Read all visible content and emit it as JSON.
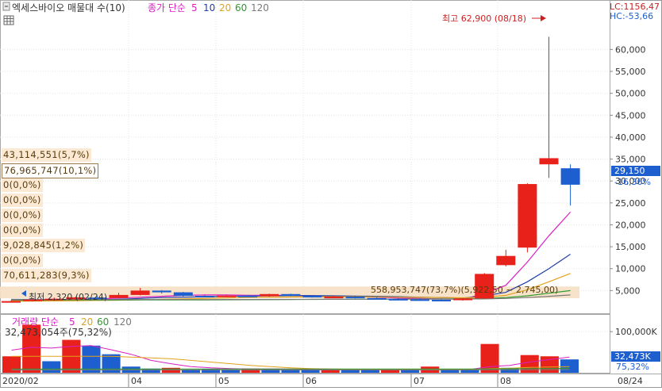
{
  "header": {
    "title": "엑세스바이오 매물대 수(10)",
    "ma_label": "종가 단순",
    "ma_periods": [
      "5",
      "10",
      "20",
      "60",
      "120"
    ]
  },
  "volume_header": {
    "label": "거래량 단순",
    "ma_periods": [
      "5",
      "20",
      "60",
      "120"
    ],
    "reading": "32,473,054주(75,32%)"
  },
  "top_right": {
    "lc": "LC:1156,47",
    "hc": "HC:-53,66"
  },
  "annotations": {
    "high": "최고 62,900 (08/18)",
    "low": "최저 2,320 (02/24)",
    "current_price": "29,150",
    "current_change": "-16,36%",
    "current_volume": "32,473K",
    "current_volume_ratio": "75,32%",
    "volume_profile_peak": "558,953,747(73,7%)(5,922,50 ~ 2,745,00)"
  },
  "volume_profile_labels": [
    "43,114,551(5,7%)",
    "76,965,747(10,1%)",
    "0(0,0%)",
    "0(0,0%)",
    "0(0,0%)",
    "0(0,0%)",
    "9,028,845(1,2%)",
    "0(0,0%)",
    "70,611,283(9,3%)"
  ],
  "colors": {
    "up": "#e8211b",
    "down": "#1e5fd0",
    "ma5": "#d81fc4",
    "ma10": "#1f3fa8",
    "ma20": "#e2a21a",
    "ma60": "#2f9a2f",
    "ma120": "#7a7a7a",
    "profile": "#f6dfc4",
    "accent": "#cc1f1f"
  },
  "chart_data": [
    {
      "type": "candlestick",
      "title": "엑세스바이오 매물대 수(10)",
      "y_axis": {
        "ticks": [
          "5,000",
          "10,000",
          "15,000",
          "20,000",
          "25,000",
          "30,000",
          "35,000",
          "40,000",
          "45,000",
          "50,000",
          "55,000",
          "60,000"
        ],
        "tick_values": [
          5000,
          10000,
          15000,
          20000,
          25000,
          30000,
          35000,
          40000,
          45000,
          50000,
          55000,
          60000
        ],
        "ylim": [
          0,
          65500
        ]
      },
      "x_axis": {
        "tick_labels": [
          "2020/02",
          "04",
          "05",
          "06",
          "07",
          "08",
          "08/24"
        ]
      },
      "candles": [
        {
          "period": "02-1",
          "open": 2500,
          "high": 2750,
          "low": 2320,
          "close": 2600
        },
        {
          "period": "02-2",
          "open": 2650,
          "high": 3000,
          "low": 2500,
          "close": 2950
        },
        {
          "period": "03-1",
          "open": 2900,
          "high": 3400,
          "low": 2700,
          "close": 3150
        },
        {
          "period": "03-2",
          "open": 3000,
          "high": 3600,
          "low": 2800,
          "close": 3450
        },
        {
          "period": "03-3",
          "open": 3400,
          "high": 3800,
          "low": 3200,
          "close": 3300
        },
        {
          "period": "03-4",
          "open": 3300,
          "high": 4500,
          "low": 3200,
          "close": 4000
        },
        {
          "period": "03-5",
          "open": 4000,
          "high": 5600,
          "low": 3900,
          "close": 5000
        },
        {
          "period": "04-1",
          "open": 5000,
          "high": 5100,
          "low": 4300,
          "close": 4600
        },
        {
          "period": "04-2",
          "open": 4600,
          "high": 4700,
          "low": 3600,
          "close": 3800
        },
        {
          "period": "04-3",
          "open": 3800,
          "high": 4000,
          "low": 3500,
          "close": 3700
        },
        {
          "period": "04-4",
          "open": 3700,
          "high": 3950,
          "low": 3500,
          "close": 3850
        },
        {
          "period": "05-1",
          "open": 3850,
          "high": 4000,
          "low": 3600,
          "close": 3700
        },
        {
          "period": "05-2",
          "open": 3700,
          "high": 4300,
          "low": 3600,
          "close": 4200
        },
        {
          "period": "05-3",
          "open": 4200,
          "high": 4300,
          "low": 3700,
          "close": 3800
        },
        {
          "period": "05-4",
          "open": 3800,
          "high": 3900,
          "low": 3400,
          "close": 3500
        },
        {
          "period": "06-1",
          "open": 3500,
          "high": 3800,
          "low": 3300,
          "close": 3600
        },
        {
          "period": "06-2",
          "open": 3600,
          "high": 3700,
          "low": 3200,
          "close": 3300
        },
        {
          "period": "06-3",
          "open": 3300,
          "high": 3500,
          "low": 3000,
          "close": 3100
        },
        {
          "period": "06-4",
          "open": 3100,
          "high": 3300,
          "low": 2900,
          "close": 3000
        },
        {
          "period": "07-1",
          "open": 3000,
          "high": 3200,
          "low": 2700,
          "close": 2900
        },
        {
          "period": "07-2",
          "open": 2900,
          "high": 3000,
          "low": 2700,
          "close": 2800
        },
        {
          "period": "07-3",
          "open": 2800,
          "high": 3300,
          "low": 2700,
          "close": 3200
        },
        {
          "period": "07-4",
          "open": 3200,
          "high": 9000,
          "low": 3100,
          "close": 8800
        },
        {
          "period": "08-1",
          "open": 10800,
          "high": 14300,
          "low": 10500,
          "close": 12900
        },
        {
          "period": "08-2",
          "open": 14800,
          "high": 29500,
          "low": 13700,
          "close": 29300
        },
        {
          "period": "08-3",
          "open": 33800,
          "high": 62900,
          "low": 30700,
          "close": 35200
        },
        {
          "period": "08-4",
          "open": 32900,
          "high": 33800,
          "low": 24400,
          "close": 29150
        }
      ],
      "moving_averages": [
        {
          "name": "5",
          "values": [
            2700,
            2800,
            2900,
            3000,
            3100,
            3300,
            3500,
            3700,
            3900,
            4000,
            4000,
            3900,
            3900,
            3900,
            3800,
            3700,
            3600,
            3500,
            3300,
            3200,
            3100,
            3000,
            4300,
            6200,
            11500,
            17500,
            22900
          ]
        },
        {
          "name": "10",
          "values": [
            2600,
            2650,
            2700,
            2800,
            2900,
            3000,
            3200,
            3400,
            3500,
            3600,
            3700,
            3750,
            3800,
            3850,
            3850,
            3800,
            3750,
            3700,
            3600,
            3500,
            3400,
            3300,
            3800,
            4600,
            7000,
            10000,
            13300
          ]
        },
        {
          "name": "20",
          "values": [
            2600,
            2600,
            2650,
            2700,
            2750,
            2800,
            2900,
            3000,
            3100,
            3200,
            3300,
            3400,
            3500,
            3550,
            3600,
            3600,
            3600,
            3550,
            3500,
            3450,
            3400,
            3350,
            3500,
            3900,
            5200,
            7000,
            8900
          ]
        },
        {
          "name": "60",
          "values": [
            2900,
            2880,
            2860,
            2850,
            2840,
            2840,
            2850,
            2860,
            2870,
            2880,
            2900,
            2920,
            2940,
            2960,
            2980,
            3000,
            3020,
            3040,
            3060,
            3080,
            3100,
            3120,
            3200,
            3400,
            3800,
            4400,
            5000
          ]
        },
        {
          "name": "120",
          "values": [
            3000,
            2990,
            2980,
            2970,
            2960,
            2950,
            2950,
            2950,
            2950,
            2950,
            2960,
            2970,
            2980,
            2990,
            3000,
            3010,
            3020,
            3030,
            3040,
            3050,
            3060,
            3070,
            3100,
            3200,
            3400,
            3700,
            4000
          ]
        }
      ],
      "volume_profile": [
        {
          "range": "2,320 ~ 5,922",
          "volume": 558953747,
          "ratio": "73,7%"
        }
      ]
    },
    {
      "type": "bar",
      "title": "거래량 단순",
      "y_axis": {
        "ticks": [
          "100,000K"
        ],
        "tick_values": [
          100000
        ],
        "ylim": [
          0,
          135000
        ]
      },
      "unit": "K",
      "values": [
        40000,
        117000,
        28000,
        80000,
        66000,
        45000,
        15000,
        10000,
        12000,
        8000,
        9000,
        8000,
        10000,
        9000,
        8000,
        7000,
        9000,
        8000,
        7000,
        8000,
        7000,
        15000,
        8000,
        7000,
        70000,
        12000,
        43000,
        40000,
        32473
      ],
      "directions": [
        "up",
        "up",
        "down",
        "up",
        "down",
        "down",
        "down",
        "down",
        "up",
        "down",
        "down",
        "down",
        "up",
        "down",
        "down",
        "down",
        "up",
        "down",
        "down",
        "up",
        "down",
        "up",
        "down",
        "down",
        "up",
        "down",
        "up",
        "up",
        "down"
      ],
      "ma": [
        {
          "name": "5",
          "values": [
            55000,
            62000,
            60000,
            64000,
            66000,
            56000,
            45000,
            30000,
            22000,
            15000,
            12000,
            10000,
            9000,
            9000,
            9000,
            8500,
            8000,
            8000,
            7800,
            7500,
            7500,
            8500,
            8500,
            8000,
            15000,
            18000,
            26000,
            32000,
            38000
          ]
        },
        {
          "name": "20",
          "values": [
            40000,
            40000,
            40000,
            40000,
            40000,
            40000,
            38000,
            36000,
            34000,
            30000,
            26000,
            22000,
            18000,
            15000,
            12000,
            10000,
            9000,
            8500,
            8000,
            8000,
            8000,
            8000,
            8000,
            8000,
            10000,
            11000,
            13000,
            14000,
            15000
          ]
        },
        {
          "name": "60",
          "values": [
            9000,
            9000,
            9000,
            9000,
            9000,
            9000,
            9000,
            9000,
            9000,
            9000,
            9000,
            9000,
            9000,
            9000,
            9000,
            9000,
            9000,
            9000,
            9000,
            9000,
            9000,
            9000,
            9000,
            9000,
            9500,
            9800,
            10200,
            10500,
            10800
          ]
        },
        {
          "name": "120",
          "values": [
            7000,
            7000,
            7000,
            7000,
            7000,
            7000,
            7000,
            7000,
            7000,
            7000,
            7000,
            7000,
            7000,
            7000,
            7000,
            7000,
            7000,
            7000,
            7000,
            7000,
            7000,
            7000,
            7000,
            7000,
            7200,
            7300,
            7500,
            7600,
            7800
          ]
        }
      ]
    }
  ]
}
